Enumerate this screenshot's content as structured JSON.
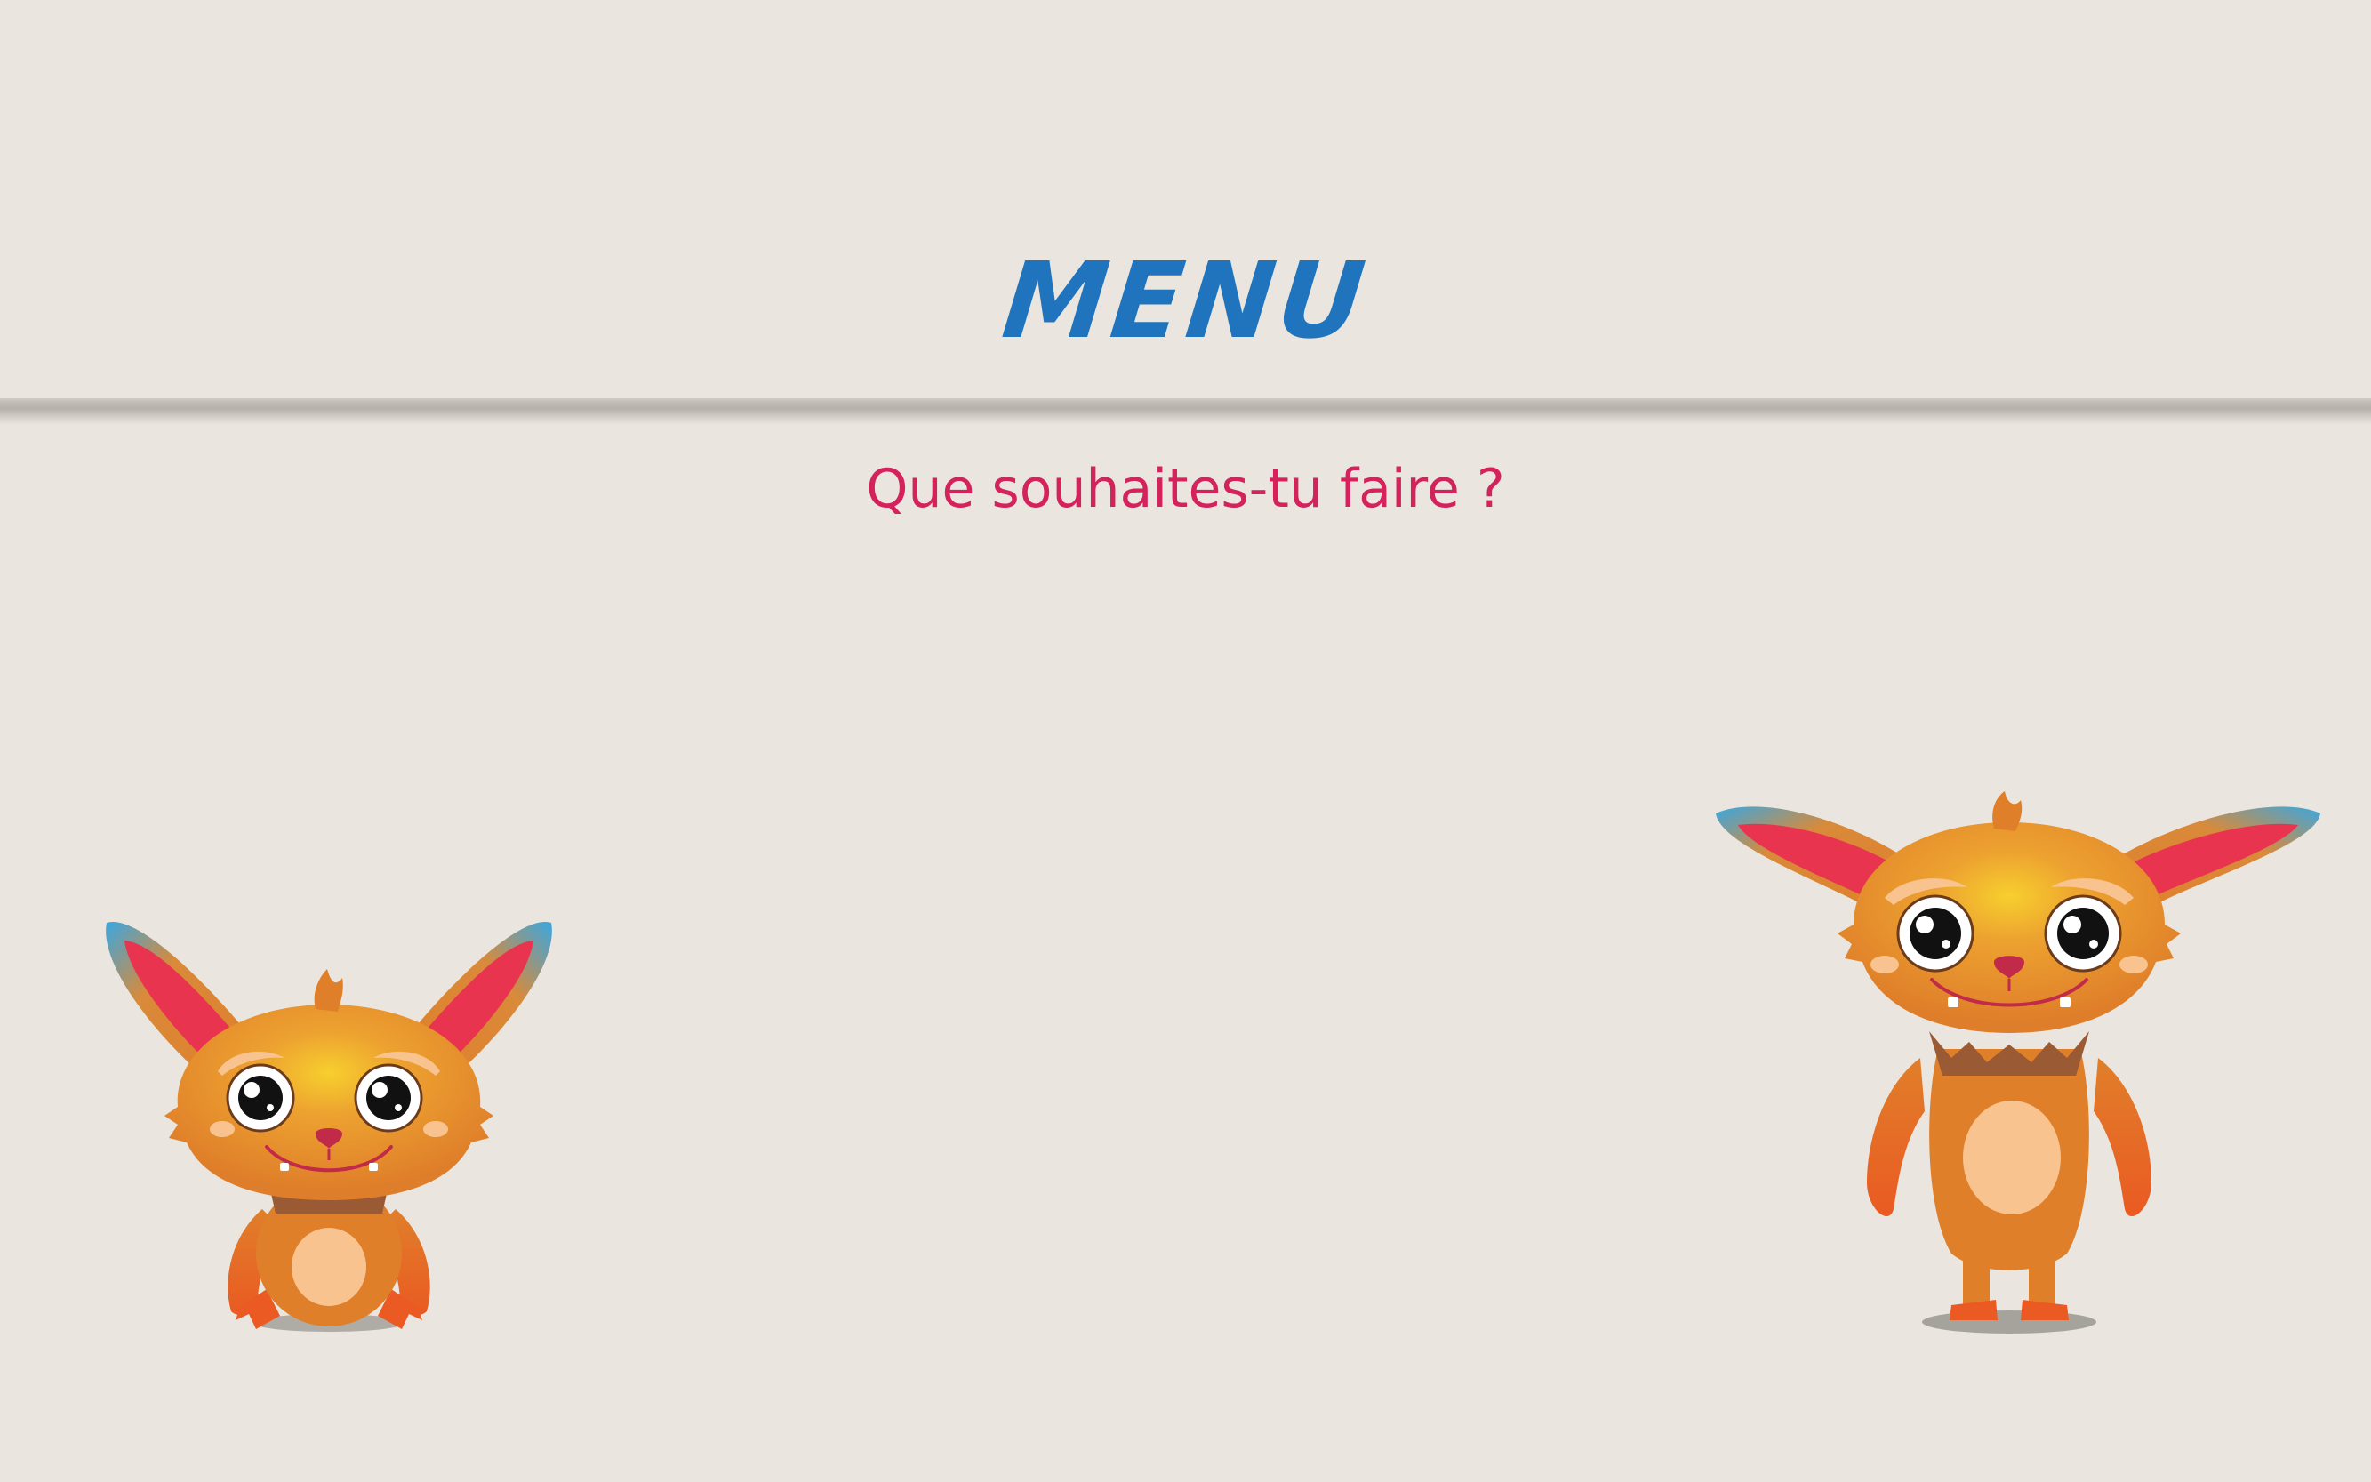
{
  "header": {
    "title": "MENU"
  },
  "prompt": {
    "text": "Que souhaites-tu faire ?"
  },
  "mascots": [
    {
      "name": "sitting-monster-mascot",
      "pose": "sitting"
    },
    {
      "name": "standing-monster-mascot",
      "pose": "standing"
    }
  ],
  "colors": {
    "background": "#eae6df",
    "title": "#1f74bd",
    "subtitle": "#d4235c",
    "monster_orange": "#e07f2a",
    "monster_belly": "#f8c38f",
    "ear_inner": "#e8344f",
    "ear_tip": "#3aa7e0"
  }
}
